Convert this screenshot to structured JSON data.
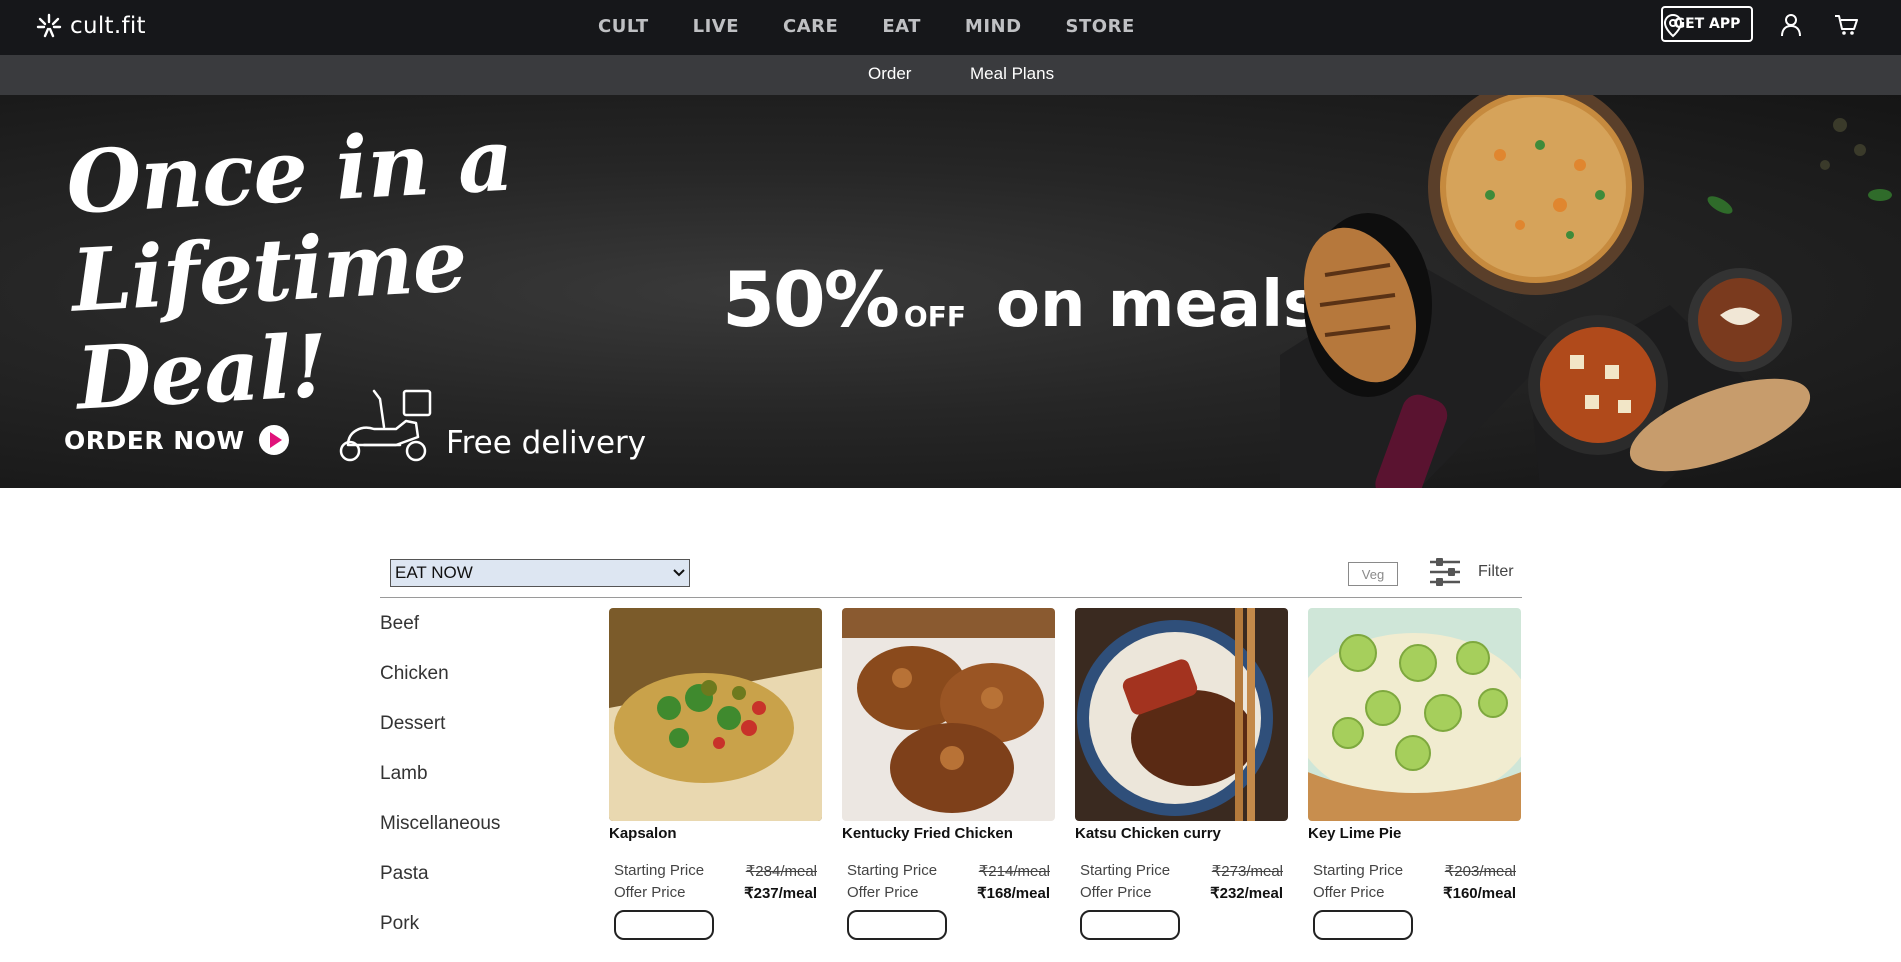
{
  "brand": {
    "name": "cult.fit"
  },
  "nav": {
    "items": [
      "CULT",
      "LIVE",
      "CARE",
      "EAT",
      "MIND",
      "STORE"
    ],
    "get_app": "GET APP",
    "icons": [
      "location-pin-icon",
      "user-icon",
      "cart-icon"
    ]
  },
  "subnav": {
    "items": [
      "Order",
      "Meal Plans"
    ]
  },
  "hero": {
    "title_line1": "Once in a Lifetime",
    "title_line2": "Deal!",
    "percent": "50%",
    "off": "OFF",
    "on_meals": "on meals",
    "order_now": "ORDER NOW",
    "free_delivery": "Free delivery",
    "accent_color": "#e0127a"
  },
  "filters": {
    "select_value": "EAT NOW",
    "veg_label": "Veg",
    "filter_label": "Filter"
  },
  "categories": [
    "Beef",
    "Chicken",
    "Dessert",
    "Lamb",
    "Miscellaneous",
    "Pasta",
    "Pork"
  ],
  "products": [
    {
      "name": "Kapsalon",
      "starting_label": "Starting Price",
      "starting_price": "₹284/meal",
      "offer_label": "Offer Price",
      "offer_price": "₹237/meal"
    },
    {
      "name": "Kentucky Fried Chicken",
      "starting_label": "Starting Price",
      "starting_price": "₹214/meal",
      "offer_label": "Offer Price",
      "offer_price": "₹168/meal"
    },
    {
      "name": "Katsu Chicken curry",
      "starting_label": "Starting Price",
      "starting_price": "₹273/meal",
      "offer_label": "Offer Price",
      "offer_price": "₹232/meal"
    },
    {
      "name": "Key Lime Pie",
      "starting_label": "Starting Price",
      "starting_price": "₹203/meal",
      "offer_label": "Offer Price",
      "offer_price": "₹160/meal"
    }
  ]
}
